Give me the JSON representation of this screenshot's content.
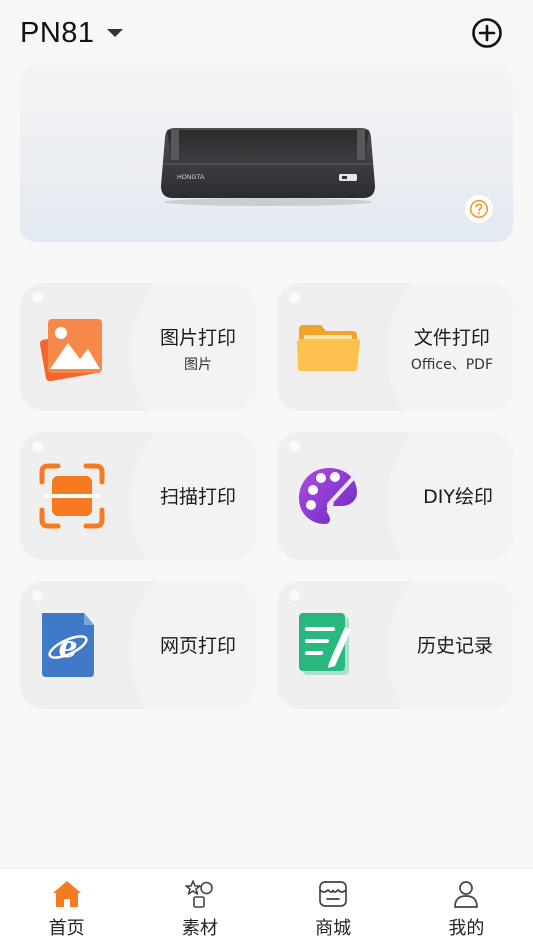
{
  "header": {
    "device_name": "PN81"
  },
  "banner": {
    "printer_brand": "HONGTA"
  },
  "features": [
    {
      "title": "图片打印",
      "subtitle": "图片",
      "icon": "image-icon"
    },
    {
      "title": "文件打印",
      "subtitle": "Office、PDF",
      "icon": "folder-icon"
    },
    {
      "title": "扫描打印",
      "subtitle": "",
      "icon": "scan-icon"
    },
    {
      "title": "DIY绘印",
      "subtitle": "",
      "icon": "palette-icon"
    },
    {
      "title": "网页打印",
      "subtitle": "",
      "icon": "web-browser-icon"
    },
    {
      "title": "历史记录",
      "subtitle": "",
      "icon": "history-note-icon"
    }
  ],
  "tabs": [
    {
      "label": "首页",
      "icon": "home-icon",
      "active": true
    },
    {
      "label": "素材",
      "icon": "materials-icon",
      "active": false
    },
    {
      "label": "商城",
      "icon": "store-icon",
      "active": false
    },
    {
      "label": "我的",
      "icon": "profile-icon",
      "active": false
    }
  ],
  "colors": {
    "accent": "#f57a22",
    "folder": "#f9b93c",
    "palette": "#8b3ad6",
    "web": "#3f79c8",
    "history": "#27b37a"
  }
}
